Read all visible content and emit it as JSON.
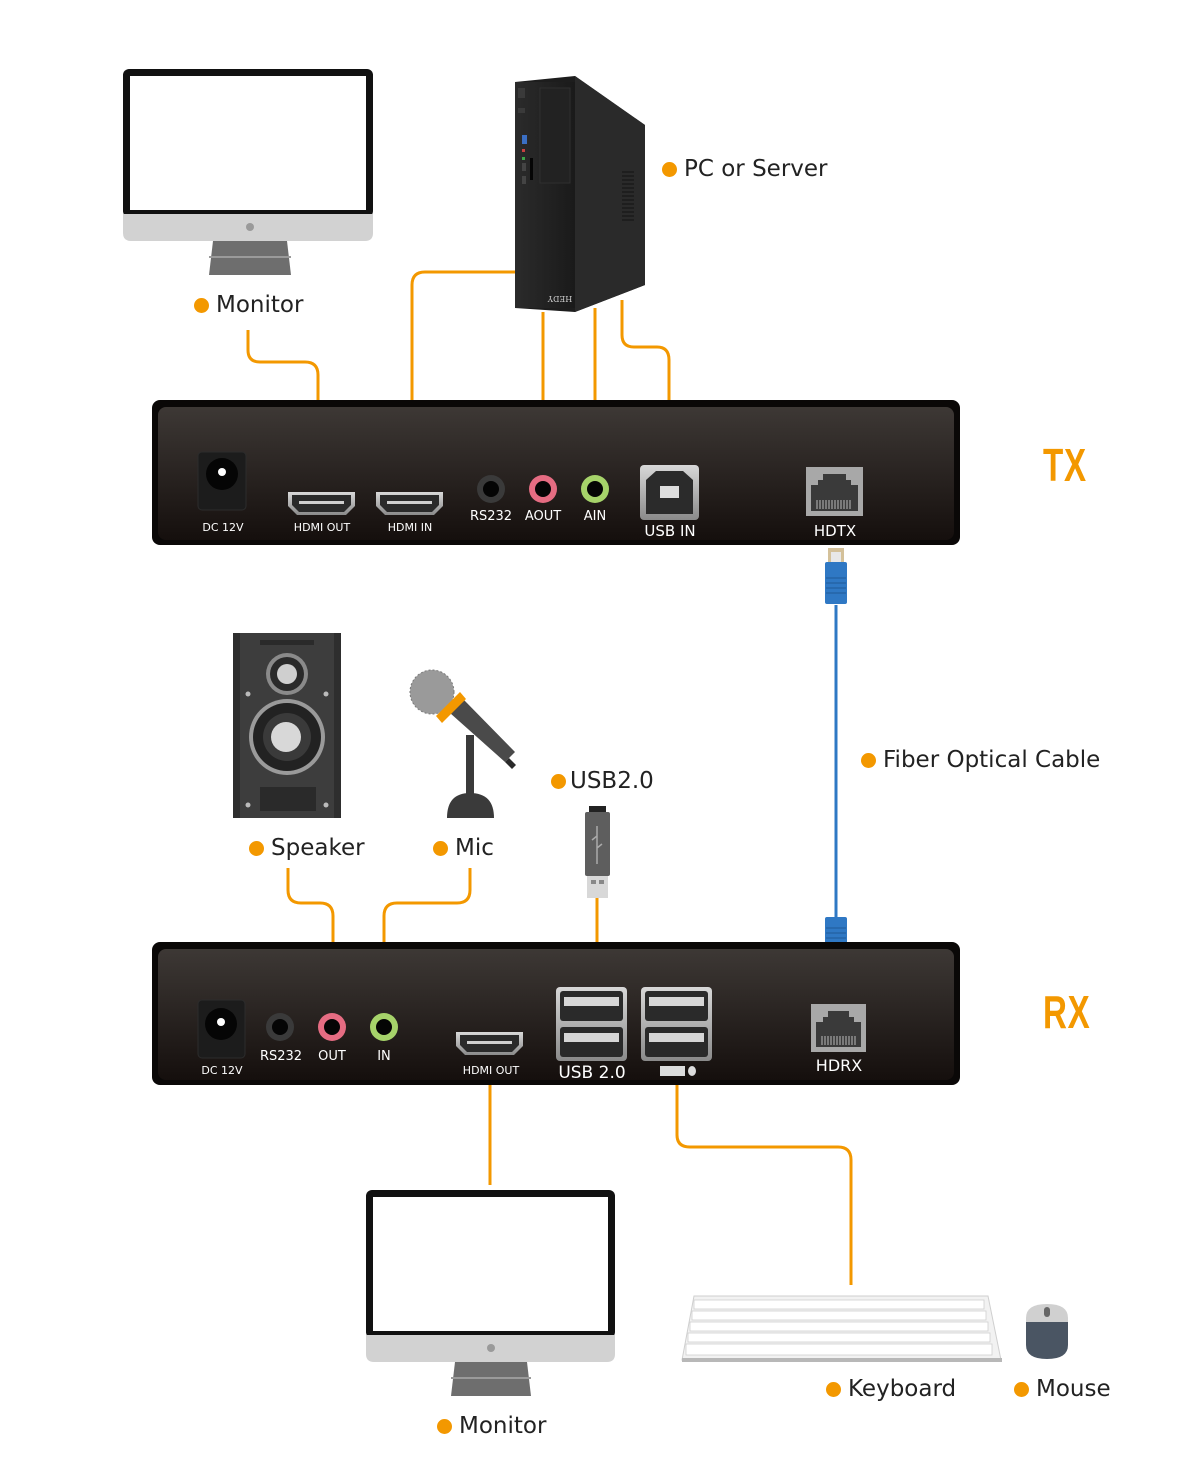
{
  "accent_color": "#f39800",
  "cable_color": "#2f78c4",
  "devices": {
    "tx_monitor": "Monitor",
    "pc": "PC or Server",
    "pc_brand": "HEDY",
    "fiber": "Fiber Optical Cable",
    "speaker": "Speaker",
    "mic": "Mic",
    "usb_drive": "USB2.0",
    "rx_monitor": "Monitor",
    "keyboard": "Keyboard",
    "mouse": "Mouse"
  },
  "tx": {
    "tag": "TX",
    "ports": {
      "dc": "DC 12V",
      "hdmi_out": "HDMI OUT",
      "hdmi_in": "HDMI IN",
      "rs232": "RS232",
      "aout": "AOUT",
      "ain": "AIN",
      "usb_in": "USB IN",
      "hdtx": "HDTX"
    }
  },
  "rx": {
    "tag": "RX",
    "ports": {
      "dc": "DC 12V",
      "rs232": "RS232",
      "out": "OUT",
      "in": "IN",
      "hdmi_out": "HDMI OUT",
      "usb": "USB 2.0",
      "hdrx": "HDRX"
    }
  }
}
